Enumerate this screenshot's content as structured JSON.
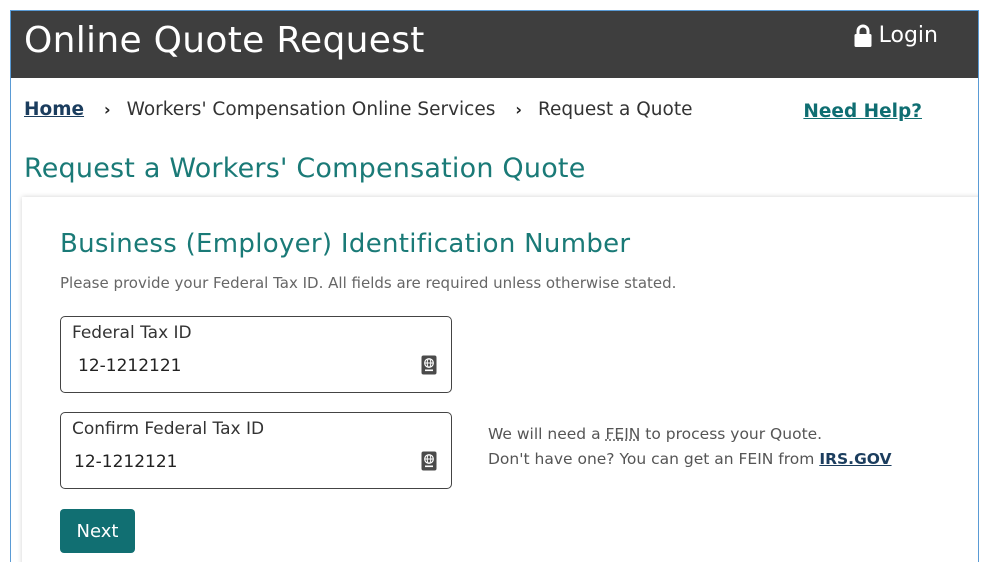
{
  "header": {
    "title": "Online Quote Request",
    "login_label": "Login",
    "login_icon": "lock-icon"
  },
  "breadcrumb": {
    "home": "Home",
    "separator": "›",
    "item1": "Workers' Compensation Online Services",
    "item2": "Request a Quote"
  },
  "help_link": "Need Help?",
  "page_title": "Request a Workers' Compensation Quote",
  "card": {
    "title": "Business (Employer) Identification Number",
    "instructions": "Please provide your Federal Tax ID. All fields are required unless otherwise stated.",
    "field1": {
      "label": "Federal Tax ID",
      "value": "12-1212121",
      "icon": "passport-icon"
    },
    "field2": {
      "label": "Confirm Federal Tax ID",
      "value": "12-1212121",
      "icon": "passport-icon"
    },
    "info": {
      "line1_prefix": "We will need a ",
      "line1_abbr": "FEIN",
      "line1_suffix": " to process your Quote.",
      "line2_prefix": "Don't have one? You can get an FEIN from ",
      "line2_link": "IRS.GOV"
    },
    "next_label": "Next"
  },
  "colors": {
    "header_bg": "#3e3e3e",
    "accent_teal": "#1a7a77",
    "button_bg": "#116f72",
    "link_navy": "#1b3d5e"
  }
}
